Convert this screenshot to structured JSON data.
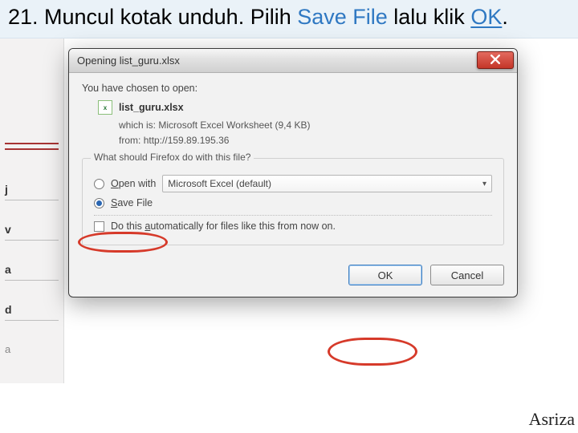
{
  "slide": {
    "title_plain_prefix": "21. Muncul kotak unduh. Pilih ",
    "title_accent_1": "Save File ",
    "title_plain_mid": "lalu klik ",
    "title_accent_2": "OK",
    "title_plain_suffix": ".",
    "attribution": "Asriza"
  },
  "peek_labels": {
    "r2": "j",
    "r3": "v",
    "r4": "a",
    "r5": "d",
    "r6": "a"
  },
  "dialog": {
    "title": "Opening list_guru.xlsx",
    "chosen_label": "You have chosen to open:",
    "file_icon_text": "x",
    "file_name": "list_guru.xlsx",
    "which_is_label": "which is:",
    "which_is_value": "Microsoft Excel Worksheet (9,4 KB)",
    "from_label": "from:",
    "from_value": "http://159.89.195.36",
    "question": "What should Firefox do with this file?",
    "open_with_prefix": "O",
    "open_with_rest": "pen with",
    "open_with_app": "Microsoft Excel (default)",
    "save_file_prefix": "S",
    "save_file_rest": "ave File",
    "auto_prefix": "Do this ",
    "auto_accel": "a",
    "auto_rest": "utomatically for files like this from now on.",
    "ok_label": "OK",
    "cancel_label": "Cancel"
  }
}
